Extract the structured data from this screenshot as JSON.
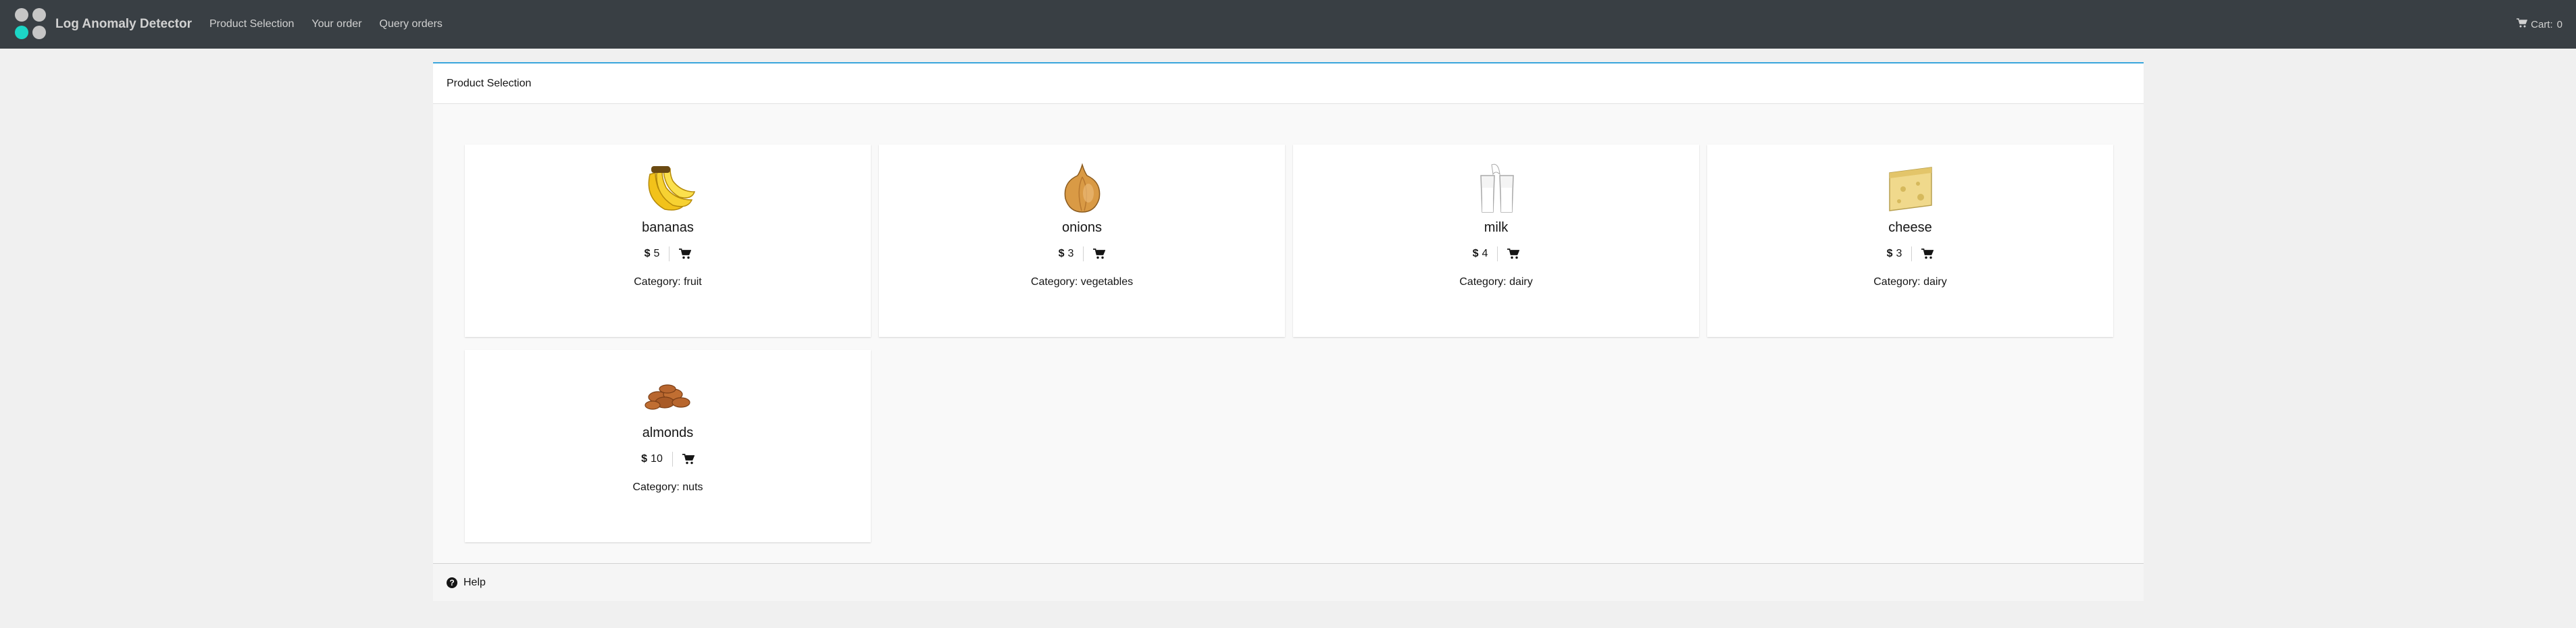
{
  "app": {
    "brand": "Log Anomaly Detector"
  },
  "nav": {
    "links": [
      "Product Selection",
      "Your order",
      "Query orders"
    ],
    "cart_label": "Cart:",
    "cart_count": "0"
  },
  "panel": {
    "title": "Product Selection",
    "help_label": "Help"
  },
  "products": [
    {
      "name": "bananas",
      "price": "5",
      "category": "Category: fruit",
      "icon": "banana-image"
    },
    {
      "name": "onions",
      "price": "3",
      "category": "Category: vegetables",
      "icon": "onion-image"
    },
    {
      "name": "milk",
      "price": "4",
      "category": "Category: dairy",
      "icon": "milk-image"
    },
    {
      "name": "cheese",
      "price": "3",
      "category": "Category: dairy",
      "icon": "cheese-image"
    },
    {
      "name": "almonds",
      "price": "10",
      "category": "Category: nuts",
      "icon": "almonds-image"
    }
  ],
  "colors": {
    "navbar": "#393f44",
    "accent": "#39a5dc",
    "logo_teal": "#1cd6c6",
    "logo_gray": "#c6c6c6"
  }
}
